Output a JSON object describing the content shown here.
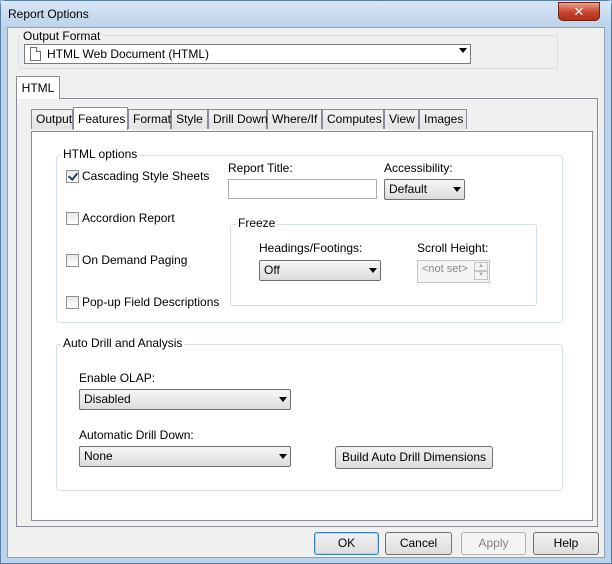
{
  "window": {
    "title": "Report Options",
    "close_glyph": "✕"
  },
  "output_format": {
    "label": "Output Format",
    "selected": "HTML Web Document (HTML)",
    "icon": "document-icon"
  },
  "outer_tab": {
    "label": "HTML"
  },
  "tabs": [
    {
      "label": "Output"
    },
    {
      "label": "Features"
    },
    {
      "label": "Format"
    },
    {
      "label": "Style"
    },
    {
      "label": "Drill Down"
    },
    {
      "label": "Where/If"
    },
    {
      "label": "Computes"
    },
    {
      "label": "View"
    },
    {
      "label": "Images"
    }
  ],
  "active_tab": "Features",
  "html_options": {
    "label": "HTML options",
    "checkboxes": [
      {
        "label": "Cascading Style Sheets",
        "checked": true
      },
      {
        "label": "Accordion Report",
        "checked": false
      },
      {
        "label": "On Demand Paging",
        "checked": false
      },
      {
        "label": "Pop-up Field Descriptions",
        "checked": false
      }
    ],
    "report_title": {
      "label": "Report Title:",
      "value": ""
    },
    "accessibility": {
      "label": "Accessibility:",
      "selected": "Default"
    },
    "freeze": {
      "label": "Freeze",
      "headings_footings": {
        "label": "Headings/Footings:",
        "selected": "Off"
      },
      "scroll_height": {
        "label": "Scroll Height:",
        "value": "<not set>"
      }
    }
  },
  "auto_drill": {
    "label": "Auto Drill and Analysis",
    "enable_olap": {
      "label": "Enable OLAP:",
      "selected": "Disabled"
    },
    "automatic_drill_down": {
      "label": "Automatic Drill Down:",
      "selected": "None"
    },
    "build_button": "Build Auto Drill Dimensions"
  },
  "buttons": {
    "ok": "OK",
    "cancel": "Cancel",
    "apply": "Apply",
    "help": "Help"
  }
}
